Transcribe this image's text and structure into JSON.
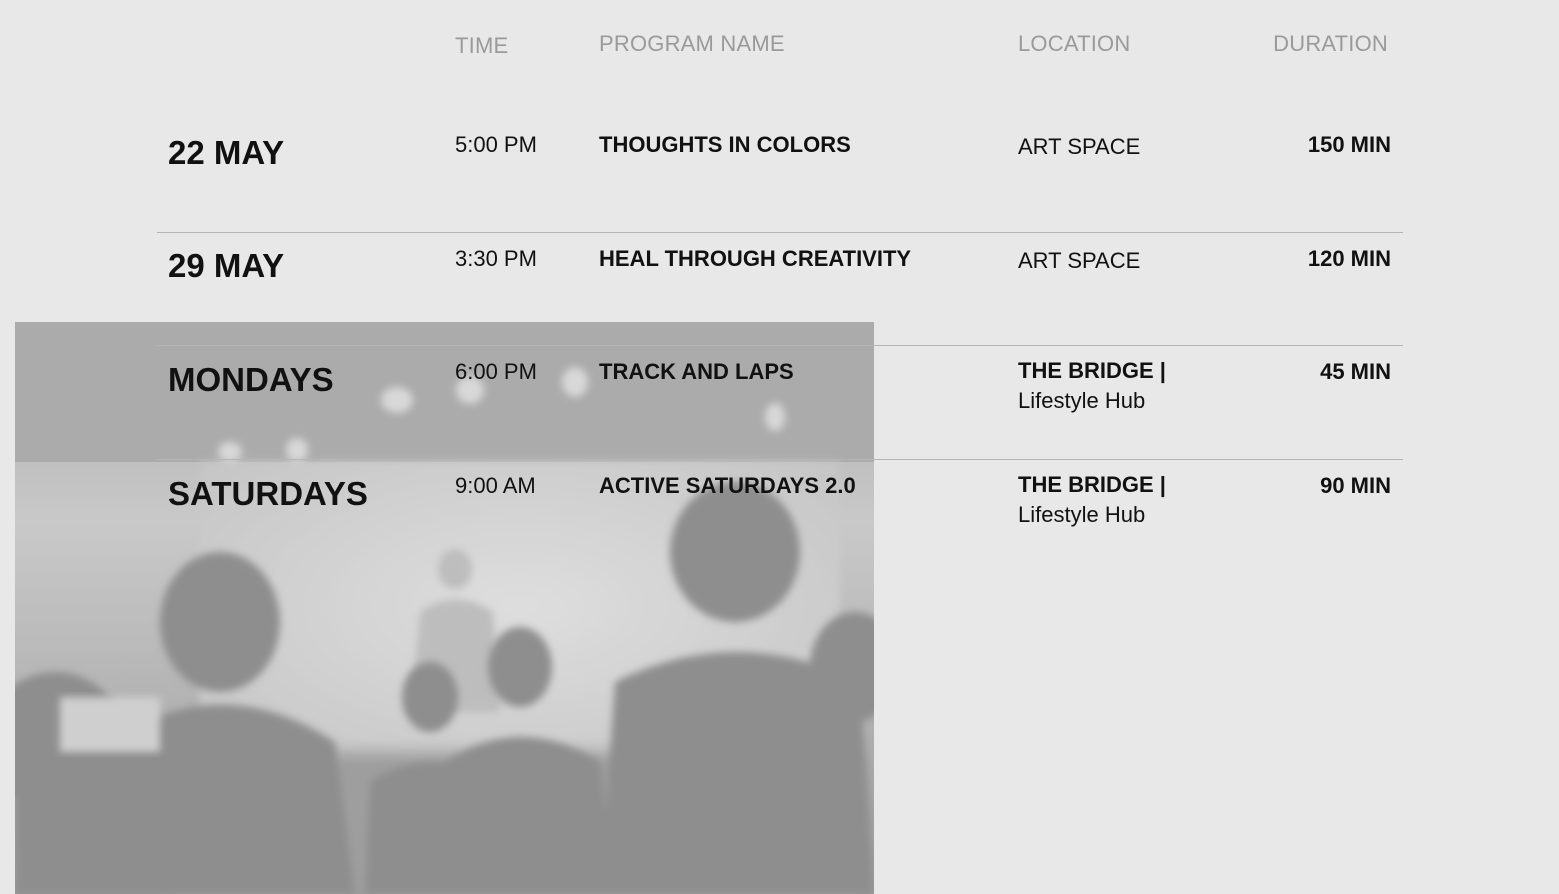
{
  "header": {
    "time": "TIME",
    "program": "PROGRAM NAME",
    "location": "LOCATION",
    "duration": "DURATION"
  },
  "rows": [
    {
      "date": "22 MAY",
      "time": "5:00 PM",
      "program": "THOUGHTS IN COLORS",
      "location_main": "ART SPACE",
      "location_sub": "",
      "duration": "150 MIN"
    },
    {
      "date": "29 MAY",
      "time": "3:30 PM",
      "program": "HEAL THROUGH CREATIVITY",
      "location_main": "ART SPACE",
      "location_sub": "",
      "duration": "120 MIN"
    },
    {
      "date": "MONDAYS",
      "time": "6:00 PM",
      "program": "TRACK AND LAPS",
      "location_main": "THE BRIDGE |",
      "location_sub": "Lifestyle Hub",
      "duration": "45 MIN"
    },
    {
      "date": "SATURDAYS",
      "time": "9:00 AM",
      "program": "ACTIVE SATURDAYS 2.0",
      "location_main": "THE BRIDGE |",
      "location_sub": "Lifestyle Hub",
      "duration": "90 MIN"
    }
  ],
  "colors": {
    "background": "#e8e8e8",
    "text": "#111111",
    "header_text": "#9a9a9a",
    "divider": "#b5b5b5"
  }
}
